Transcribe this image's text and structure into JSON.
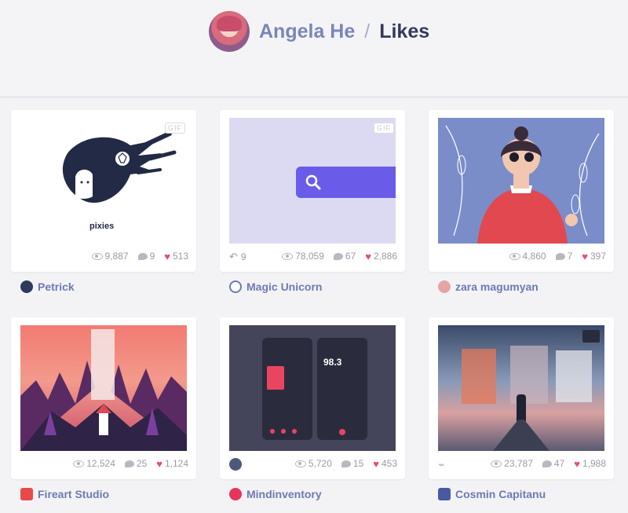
{
  "header": {
    "user_name": "Angela He",
    "separator": "/",
    "page_title": "Likes"
  },
  "shots": [
    {
      "author": "Petrick",
      "gif_badge": "GIF",
      "views": "9,887",
      "comments": "9",
      "likes": "513",
      "thumb_text": "pixies",
      "avatar_color": "#2e3a5c"
    },
    {
      "author": "Magic Unicorn",
      "gif_badge": "GIF",
      "rebounds": "9",
      "views": "78,059",
      "comments": "67",
      "likes": "2,886",
      "avatar_color": "#6d7ab3"
    },
    {
      "author": "zara magumyan",
      "views": "4,860",
      "comments": "7",
      "likes": "397",
      "avatar_color": "#e6a4a4"
    },
    {
      "author": "Fireart Studio",
      "views": "12,524",
      "comments": "25",
      "likes": "1,124",
      "avatar_color": "#e84a4a"
    },
    {
      "author": "Mindinventory",
      "views": "5,720",
      "comments": "15",
      "likes": "453",
      "thumb_text": "98.3",
      "avatar_color": "#e8345a"
    },
    {
      "author": "Cosmin Capitanu",
      "views": "23,787",
      "comments": "47",
      "likes": "1,988",
      "avatar_color": "#4a5aa0"
    }
  ],
  "colors": {
    "accent_author": "#6d7ab3",
    "heart": "#ea4c6c",
    "title_dark": "#333b5c"
  },
  "icons": [
    "eye-icon",
    "comment-icon",
    "heart-icon",
    "rebound-icon",
    "attachment-icon",
    "video-icon",
    "search-icon"
  ]
}
